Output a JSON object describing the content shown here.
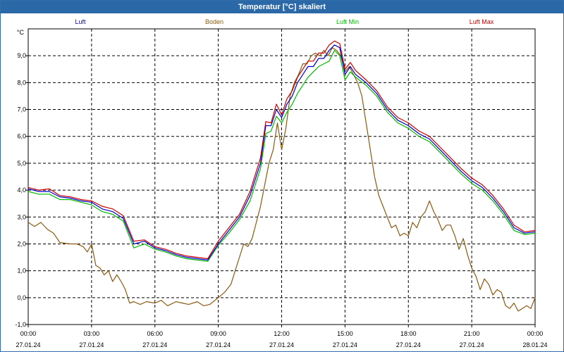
{
  "window": {
    "title": "Temperatur [°C] skaliert"
  },
  "chart_data": {
    "type": "line",
    "title": "Temperatur [°C] skaliert",
    "ylabel": "°C",
    "xlabel": "",
    "ylim": [
      -1.0,
      10.0
    ],
    "yticks": [
      "-1,0",
      "0,0",
      "1,0",
      "2,0",
      "3,0",
      "4,0",
      "5,0",
      "6,0",
      "7,0",
      "8,0",
      "9,0"
    ],
    "xlim_hours": [
      0,
      24
    ],
    "xticks": [
      {
        "time": "00:00",
        "date": "27.01.24"
      },
      {
        "time": "03:00",
        "date": "27.01.24"
      },
      {
        "time": "06:00",
        "date": "27.01.24"
      },
      {
        "time": "09:00",
        "date": "27.01.24"
      },
      {
        "time": "12:00",
        "date": "27.01.24"
      },
      {
        "time": "15:00",
        "date": "27.01.24"
      },
      {
        "time": "18:00",
        "date": "27.01.24"
      },
      {
        "time": "21:00",
        "date": "27.01.24"
      },
      {
        "time": "00:00",
        "date": "28.01.24"
      }
    ],
    "grid": true,
    "legend_position": "top",
    "series": [
      {
        "name": "Luft",
        "color": "#0000cc",
        "points": [
          [
            0.0,
            4.05
          ],
          [
            0.5,
            3.95
          ],
          [
            1.0,
            3.95
          ],
          [
            1.5,
            3.75
          ],
          [
            2.0,
            3.7
          ],
          [
            2.5,
            3.6
          ],
          [
            3.0,
            3.55
          ],
          [
            3.5,
            3.3
          ],
          [
            4.0,
            3.2
          ],
          [
            4.5,
            2.95
          ],
          [
            5.0,
            2.0
          ],
          [
            5.5,
            2.1
          ],
          [
            6.0,
            1.85
          ],
          [
            6.5,
            1.75
          ],
          [
            7.0,
            1.6
          ],
          [
            7.5,
            1.5
          ],
          [
            8.0,
            1.45
          ],
          [
            8.5,
            1.4
          ],
          [
            9.0,
            2.0
          ],
          [
            9.5,
            2.5
          ],
          [
            10.0,
            3.0
          ],
          [
            10.5,
            3.8
          ],
          [
            11.0,
            5.0
          ],
          [
            11.25,
            6.4
          ],
          [
            11.5,
            6.4
          ],
          [
            11.75,
            7.0
          ],
          [
            12.0,
            6.7
          ],
          [
            12.25,
            7.2
          ],
          [
            12.5,
            7.5
          ],
          [
            12.75,
            8.0
          ],
          [
            13.0,
            8.3
          ],
          [
            13.25,
            8.6
          ],
          [
            13.5,
            8.6
          ],
          [
            13.75,
            8.9
          ],
          [
            14.0,
            8.9
          ],
          [
            14.25,
            9.2
          ],
          [
            14.5,
            9.4
          ],
          [
            14.75,
            9.3
          ],
          [
            15.0,
            8.3
          ],
          [
            15.25,
            8.6
          ],
          [
            15.5,
            8.3
          ],
          [
            16.0,
            8.0
          ],
          [
            16.5,
            7.6
          ],
          [
            17.0,
            7.0
          ],
          [
            17.5,
            6.6
          ],
          [
            18.0,
            6.4
          ],
          [
            18.5,
            6.1
          ],
          [
            19.0,
            5.9
          ],
          [
            19.5,
            5.5
          ],
          [
            20.0,
            5.1
          ],
          [
            20.5,
            4.7
          ],
          [
            21.0,
            4.35
          ],
          [
            21.5,
            4.1
          ],
          [
            22.0,
            3.7
          ],
          [
            22.5,
            3.2
          ],
          [
            23.0,
            2.6
          ],
          [
            23.5,
            2.4
          ],
          [
            24.0,
            2.45
          ]
        ]
      },
      {
        "name": "Boden",
        "color": "#8b5a10",
        "points": [
          [
            0.0,
            2.8
          ],
          [
            0.3,
            2.65
          ],
          [
            0.6,
            2.8
          ],
          [
            0.9,
            2.55
          ],
          [
            1.2,
            2.4
          ],
          [
            1.5,
            2.05
          ],
          [
            2.0,
            2.0
          ],
          [
            2.3,
            2.0
          ],
          [
            2.6,
            1.9
          ],
          [
            2.8,
            1.7
          ],
          [
            3.0,
            2.0
          ],
          [
            3.2,
            1.2
          ],
          [
            3.4,
            1.1
          ],
          [
            3.6,
            0.85
          ],
          [
            3.8,
            1.0
          ],
          [
            4.0,
            0.6
          ],
          [
            4.2,
            0.85
          ],
          [
            4.4,
            0.6
          ],
          [
            4.6,
            0.3
          ],
          [
            4.8,
            -0.2
          ],
          [
            5.0,
            -0.15
          ],
          [
            5.3,
            -0.25
          ],
          [
            5.6,
            -0.15
          ],
          [
            6.0,
            -0.2
          ],
          [
            6.3,
            -0.1
          ],
          [
            6.6,
            -0.3
          ],
          [
            7.0,
            -0.15
          ],
          [
            7.3,
            -0.2
          ],
          [
            7.6,
            -0.25
          ],
          [
            8.0,
            -0.15
          ],
          [
            8.3,
            -0.3
          ],
          [
            8.6,
            -0.25
          ],
          [
            9.0,
            0.0
          ],
          [
            9.3,
            0.2
          ],
          [
            9.6,
            0.5
          ],
          [
            9.8,
            1.0
          ],
          [
            10.0,
            1.5
          ],
          [
            10.2,
            2.0
          ],
          [
            10.4,
            1.9
          ],
          [
            10.6,
            2.2
          ],
          [
            10.8,
            2.8
          ],
          [
            11.0,
            3.4
          ],
          [
            11.2,
            4.2
          ],
          [
            11.4,
            5.0
          ],
          [
            11.6,
            5.5
          ],
          [
            11.8,
            6.5
          ],
          [
            12.0,
            5.5
          ],
          [
            12.2,
            6.3
          ],
          [
            12.4,
            7.5
          ],
          [
            12.6,
            8.0
          ],
          [
            12.8,
            8.3
          ],
          [
            13.0,
            8.7
          ],
          [
            13.2,
            8.7
          ],
          [
            13.4,
            9.0
          ],
          [
            13.6,
            9.1
          ],
          [
            13.8,
            9.0
          ],
          [
            14.0,
            9.2
          ],
          [
            14.2,
            9.0
          ],
          [
            14.4,
            9.3
          ],
          [
            14.6,
            9.2
          ],
          [
            14.8,
            9.0
          ],
          [
            15.0,
            8.4
          ],
          [
            15.2,
            8.6
          ],
          [
            15.4,
            8.3
          ],
          [
            15.6,
            8.0
          ],
          [
            15.8,
            7.5
          ],
          [
            16.0,
            6.5
          ],
          [
            16.2,
            5.5
          ],
          [
            16.4,
            4.5
          ],
          [
            16.6,
            3.8
          ],
          [
            16.8,
            3.4
          ],
          [
            17.0,
            3.0
          ],
          [
            17.2,
            2.6
          ],
          [
            17.4,
            2.7
          ],
          [
            17.6,
            2.3
          ],
          [
            17.8,
            2.4
          ],
          [
            18.0,
            2.3
          ],
          [
            18.2,
            2.8
          ],
          [
            18.4,
            2.6
          ],
          [
            18.6,
            3.0
          ],
          [
            18.8,
            3.2
          ],
          [
            19.0,
            3.6
          ],
          [
            19.2,
            3.2
          ],
          [
            19.4,
            2.9
          ],
          [
            19.6,
            2.5
          ],
          [
            19.8,
            2.7
          ],
          [
            20.0,
            2.7
          ],
          [
            20.2,
            2.3
          ],
          [
            20.4,
            1.8
          ],
          [
            20.6,
            2.2
          ],
          [
            20.8,
            1.6
          ],
          [
            21.0,
            1.1
          ],
          [
            21.2,
            0.8
          ],
          [
            21.4,
            0.3
          ],
          [
            21.6,
            0.7
          ],
          [
            21.8,
            0.5
          ],
          [
            22.0,
            0.1
          ],
          [
            22.2,
            0.3
          ],
          [
            22.4,
            0.2
          ],
          [
            22.6,
            -0.3
          ],
          [
            22.8,
            -0.4
          ],
          [
            23.0,
            -0.2
          ],
          [
            23.2,
            -0.5
          ],
          [
            23.4,
            -0.4
          ],
          [
            23.6,
            -0.3
          ],
          [
            23.8,
            -0.4
          ],
          [
            24.0,
            0.0
          ]
        ]
      },
      {
        "name": "Luft Min",
        "color": "#00bb00",
        "points": [
          [
            0.0,
            3.95
          ],
          [
            0.5,
            3.85
          ],
          [
            1.0,
            3.85
          ],
          [
            1.5,
            3.65
          ],
          [
            2.0,
            3.65
          ],
          [
            2.5,
            3.55
          ],
          [
            3.0,
            3.45
          ],
          [
            3.5,
            3.2
          ],
          [
            4.0,
            3.1
          ],
          [
            4.5,
            2.85
          ],
          [
            5.0,
            1.85
          ],
          [
            5.5,
            2.0
          ],
          [
            6.0,
            1.8
          ],
          [
            6.5,
            1.7
          ],
          [
            7.0,
            1.55
          ],
          [
            7.5,
            1.45
          ],
          [
            8.0,
            1.4
          ],
          [
            8.5,
            1.35
          ],
          [
            9.0,
            1.95
          ],
          [
            9.5,
            2.4
          ],
          [
            10.0,
            2.9
          ],
          [
            10.5,
            3.6
          ],
          [
            11.0,
            4.8
          ],
          [
            11.25,
            6.1
          ],
          [
            11.5,
            6.2
          ],
          [
            11.75,
            6.75
          ],
          [
            12.0,
            6.5
          ],
          [
            12.25,
            6.9
          ],
          [
            12.5,
            7.2
          ],
          [
            12.75,
            7.6
          ],
          [
            13.0,
            7.9
          ],
          [
            13.25,
            8.2
          ],
          [
            13.5,
            8.4
          ],
          [
            13.75,
            8.6
          ],
          [
            14.0,
            8.7
          ],
          [
            14.25,
            8.8
          ],
          [
            14.5,
            9.2
          ],
          [
            14.75,
            9.0
          ],
          [
            15.0,
            8.1
          ],
          [
            15.25,
            8.4
          ],
          [
            15.5,
            8.2
          ],
          [
            16.0,
            7.9
          ],
          [
            16.5,
            7.5
          ],
          [
            17.0,
            6.9
          ],
          [
            17.5,
            6.5
          ],
          [
            18.0,
            6.3
          ],
          [
            18.5,
            6.0
          ],
          [
            19.0,
            5.8
          ],
          [
            19.5,
            5.4
          ],
          [
            20.0,
            5.0
          ],
          [
            20.5,
            4.6
          ],
          [
            21.0,
            4.25
          ],
          [
            21.5,
            4.0
          ],
          [
            22.0,
            3.6
          ],
          [
            22.5,
            3.1
          ],
          [
            23.0,
            2.5
          ],
          [
            23.5,
            2.35
          ],
          [
            24.0,
            2.4
          ]
        ]
      },
      {
        "name": "Luft Max",
        "color": "#cc0000",
        "points": [
          [
            0.0,
            4.1
          ],
          [
            0.5,
            4.0
          ],
          [
            1.0,
            4.05
          ],
          [
            1.5,
            3.8
          ],
          [
            2.0,
            3.75
          ],
          [
            2.5,
            3.65
          ],
          [
            3.0,
            3.6
          ],
          [
            3.5,
            3.4
          ],
          [
            4.0,
            3.3
          ],
          [
            4.5,
            3.05
          ],
          [
            5.0,
            2.1
          ],
          [
            5.5,
            2.15
          ],
          [
            6.0,
            1.9
          ],
          [
            6.5,
            1.8
          ],
          [
            7.0,
            1.65
          ],
          [
            7.5,
            1.55
          ],
          [
            8.0,
            1.5
          ],
          [
            8.5,
            1.45
          ],
          [
            9.0,
            2.1
          ],
          [
            9.5,
            2.6
          ],
          [
            10.0,
            3.1
          ],
          [
            10.5,
            3.95
          ],
          [
            11.0,
            5.2
          ],
          [
            11.25,
            6.55
          ],
          [
            11.5,
            6.5
          ],
          [
            11.75,
            7.2
          ],
          [
            12.0,
            6.8
          ],
          [
            12.25,
            7.4
          ],
          [
            12.5,
            7.7
          ],
          [
            12.75,
            8.2
          ],
          [
            13.0,
            8.5
          ],
          [
            13.25,
            8.8
          ],
          [
            13.5,
            8.8
          ],
          [
            13.75,
            9.1
          ],
          [
            14.0,
            9.1
          ],
          [
            14.25,
            9.4
          ],
          [
            14.5,
            9.55
          ],
          [
            14.75,
            9.45
          ],
          [
            15.0,
            8.5
          ],
          [
            15.25,
            8.75
          ],
          [
            15.5,
            8.45
          ],
          [
            16.0,
            8.1
          ],
          [
            16.5,
            7.7
          ],
          [
            17.0,
            7.1
          ],
          [
            17.5,
            6.7
          ],
          [
            18.0,
            6.5
          ],
          [
            18.5,
            6.2
          ],
          [
            19.0,
            6.0
          ],
          [
            19.5,
            5.6
          ],
          [
            20.0,
            5.2
          ],
          [
            20.5,
            4.8
          ],
          [
            21.0,
            4.45
          ],
          [
            21.5,
            4.2
          ],
          [
            22.0,
            3.8
          ],
          [
            22.5,
            3.3
          ],
          [
            23.0,
            2.7
          ],
          [
            23.5,
            2.45
          ],
          [
            24.0,
            2.5
          ]
        ]
      }
    ]
  }
}
